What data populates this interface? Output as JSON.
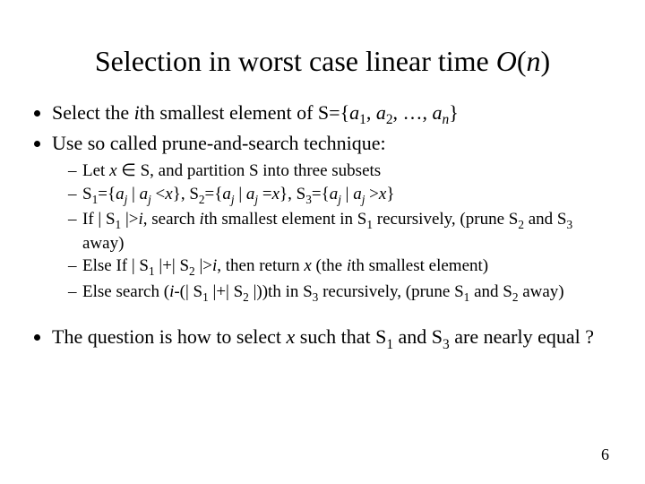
{
  "title": {
    "pre": "Selection in worst case linear time ",
    "O": "O",
    "open": "(",
    "n": "n",
    "close": ")"
  },
  "b1": {
    "pre": "Select the ",
    "i": "i",
    "mid": "th smallest element of S={",
    "a1a": "a",
    "a1s": "1",
    "c1": ", ",
    "a2a": "a",
    "a2s": "2",
    "c2": ", …, ",
    "ana": "a",
    "ans": "n",
    "end": "}"
  },
  "b2": "Use so called prune-and-search technique:",
  "s1": {
    "pre": "Let ",
    "x": "x",
    "in": " ∈ S, and partition S into three  subsets"
  },
  "s2": {
    "t1": "S",
    "s1": "1",
    "t2": "={",
    "a1": "a",
    "aj1": "j",
    "t3": " | ",
    "a2": "a",
    "aj2": "j",
    "t4": " <",
    "x1": "x",
    "t5": "}, S",
    "s2": "2",
    "t6": "={",
    "a3": "a",
    "aj3": "j",
    "t7": " | ",
    "a4": "a",
    "aj4": "j",
    "t8": " =",
    "x2": "x",
    "t9": "}, S",
    "s3": "3",
    "t10": "={",
    "a5": "a",
    "aj5": "j",
    "t11": " | ",
    "a6": "a",
    "aj6": "j",
    "t12": " >",
    "x3": "x",
    "t13": "}"
  },
  "s3": {
    "t1": "If | S",
    "s1": "1",
    "t2": " |>",
    "i1": "i",
    "t3": ", search ",
    "i2": "i",
    "t4": "th smallest element in S",
    "s1b": "1",
    "t5": " recursively, (prune S",
    "s2": "2",
    "t6": " and S",
    "s3": "3",
    "t7": " away)"
  },
  "s4": {
    "t1": "Else If | S",
    "s1": "1",
    "t2": " |+| S",
    "s2": "2",
    "t3": " |>",
    "i1": "i",
    "t4": ", then return ",
    "x": "x",
    "t5": " (the ",
    "i2": "i",
    "t6": "th smallest element)"
  },
  "s5": {
    "t1": "Else search (",
    "i": "i",
    "t2": "-(| S",
    "s1": "1",
    "t3": " |+| S",
    "s2": "2",
    "t4": " |))th in S",
    "s3": "3",
    "t5": " recursively, (prune S",
    "s1b": "1",
    "t6": " and S",
    "s2b": "2",
    "t7": " away)"
  },
  "b3": {
    "t1": "The question is how to select ",
    "x": "x",
    "t2": " such that S",
    "s1": "1",
    "t3": " and S",
    "s3": "3",
    "t4": " are nearly equal ?"
  },
  "page": "6"
}
